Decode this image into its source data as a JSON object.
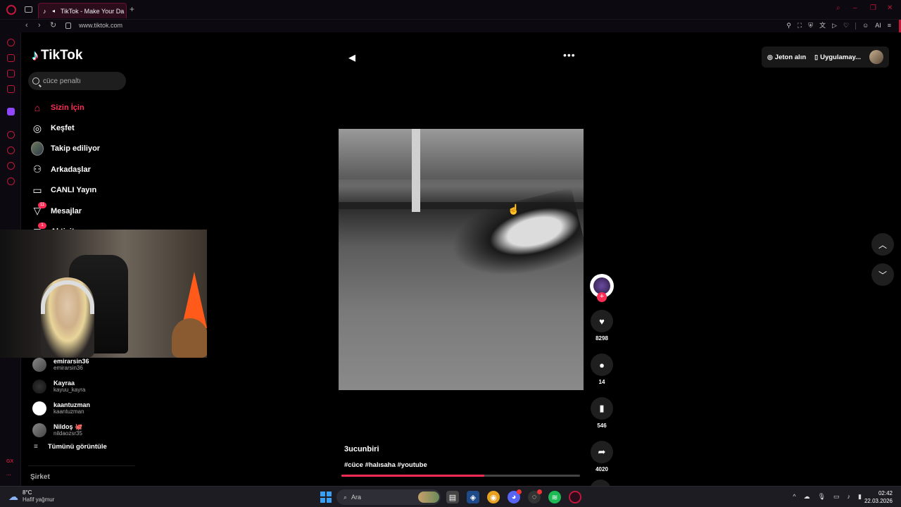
{
  "browser": {
    "tab_title": "TikTok - Make Your Da",
    "url": "www.tiktok.com",
    "toolbar_ai": "AI"
  },
  "sidebar": {
    "logo": "TikTok",
    "search_placeholder": "cüce penaltı",
    "nav": [
      {
        "label": "Sizin İçin",
        "icon": "home-icon",
        "active": true
      },
      {
        "label": "Keşfet",
        "icon": "compass-icon"
      },
      {
        "label": "Takip ediliyor",
        "icon": "avatar-icon"
      },
      {
        "label": "Arkadaşlar",
        "icon": "friends-icon"
      },
      {
        "label": "CANLI Yayın",
        "icon": "live-tv-icon"
      },
      {
        "label": "Mesajlar",
        "icon": "messages-icon",
        "badge": "11"
      },
      {
        "label": "Aktivite",
        "icon": "activity-icon",
        "badge": "1"
      }
    ],
    "following": [
      {
        "name": "emirarsin36",
        "handle": "emirarsin36"
      },
      {
        "name": "Kayraa",
        "handle": "kayuu_kayra"
      },
      {
        "name": "kaantuzman",
        "handle": "kaantuzman"
      },
      {
        "name": "Nildoş 🐙",
        "handle": "nildaozsr35"
      }
    ],
    "see_all": "Tümünü görüntüle",
    "company": "Şirket"
  },
  "top_right": {
    "coins": "Jeton alın",
    "app": "Uygulamay..."
  },
  "video": {
    "username": "3ucunbiri",
    "hashtags": "#cüce #halısaha #youtube",
    "progress": 0.6,
    "likes": "8298",
    "comments": "14",
    "saves": "546",
    "shares": "4020"
  },
  "taskbar": {
    "weather_temp": "8°C",
    "weather_desc": "Hafif yağmur",
    "search": "Ara",
    "time": "02:42",
    "date": "22.03.2026"
  },
  "colors": {
    "accent": "#fe2c55",
    "opera": "#c2163a"
  }
}
